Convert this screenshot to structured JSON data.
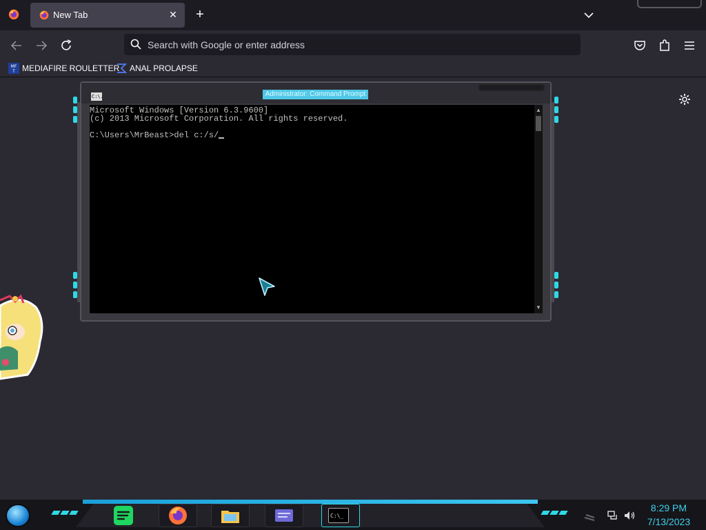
{
  "browser": {
    "tab": {
      "title": "New Tab"
    },
    "urlbar": {
      "placeholder": "Search with Google or enter address"
    },
    "bookmarks": [
      {
        "label": "MEDIAFIRE ROULETTER",
        "icon": "mft-icon"
      },
      {
        "label": "ANAL PROLAPSE",
        "icon": "sigma-icon"
      }
    ]
  },
  "cmd": {
    "title": "Administrator: Command Prompt",
    "icon_text": "C:\\.",
    "lines": [
      "Microsoft Windows [Version 6.3.9600]",
      "(c) 2013 Microsoft Corporation. All rights reserved.",
      "C:\\Users\\MrBeast>del c:/s/"
    ]
  },
  "taskbar": {
    "time": "8:29 PM",
    "date": "7/13/2023",
    "cmd_icon_text": "C:\\_",
    "apps": [
      "spotify-icon",
      "firefox-icon",
      "file-explorer-icon",
      "control-panel-icon",
      "command-prompt-icon"
    ]
  },
  "colors": {
    "accent": "#2fd8e6",
    "chrome_bg": "#1c1b22",
    "page_bg": "#2b2a33",
    "clock": "#3fd0ea"
  }
}
